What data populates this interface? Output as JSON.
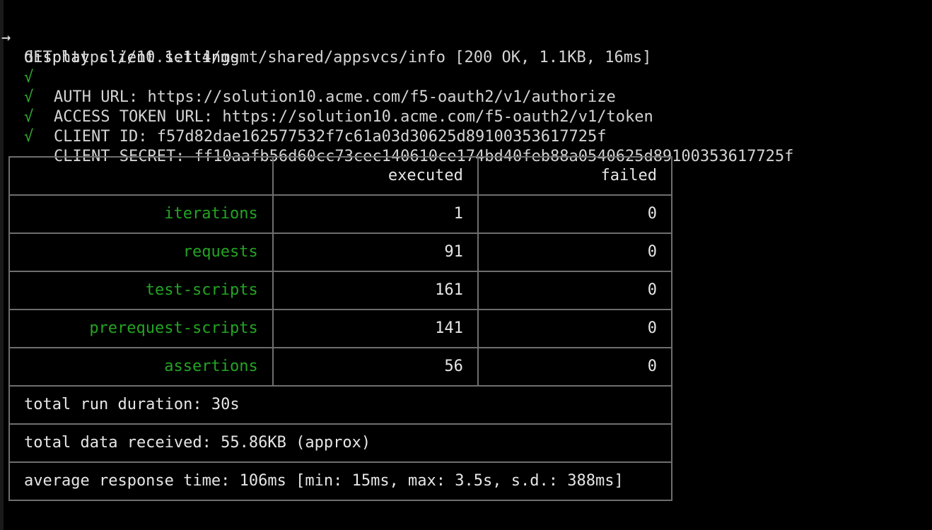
{
  "terminal": {
    "prompt_arrow": "→",
    "command": "display client settings",
    "request_line": "GET https://10.1.1.4/mgmt/shared/appsvcs/info [200 OK, 1.1KB, 16ms]",
    "check_glyph": "√",
    "checks": [
      "AUTH URL: https://solution10.acme.com/f5-oauth2/v1/authorize",
      "ACCESS TOKEN URL: https://solution10.acme.com/f5-oauth2/v1/token",
      "CLIENT ID: f57d82dae162577532f7c61a03d30625d89100353617725f",
      "CLIENT SECRET: ff10aafb56d60cc73cec140610ce174bd40feb88a0540625d89100353617725f"
    ]
  },
  "summary": {
    "headers": [
      "",
      "executed",
      "failed"
    ],
    "rows": [
      {
        "label": "iterations",
        "executed": "1",
        "failed": "0"
      },
      {
        "label": "requests",
        "executed": "91",
        "failed": "0"
      },
      {
        "label": "test-scripts",
        "executed": "161",
        "failed": "0"
      },
      {
        "label": "prerequest-scripts",
        "executed": "141",
        "failed": "0"
      },
      {
        "label": "assertions",
        "executed": "56",
        "failed": "0"
      }
    ],
    "totals": [
      "total run duration: 30s",
      "total data received: 55.86KB (approx)",
      "average response time: 106ms [min: 15ms, max: 3.5s, s.d.: 388ms]"
    ]
  },
  "colors": {
    "background": "#000000",
    "text": "#e6e6e6",
    "label_green": "#23a423",
    "check_green": "#2faa2f",
    "border": "#6e6e6e"
  }
}
